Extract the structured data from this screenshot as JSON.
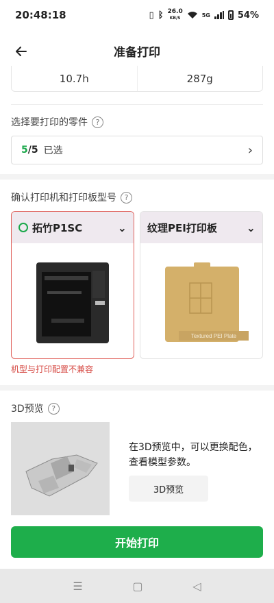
{
  "status_bar": {
    "time": "20:48:18",
    "net_speed": "26.0",
    "net_unit": "KB/S",
    "network": "5G",
    "battery": "54%"
  },
  "header": {
    "title": "准备打印"
  },
  "stats": {
    "time": "10.7h",
    "weight": "287g"
  },
  "parts": {
    "label": "选择要打印的零件",
    "selected": "5",
    "total": "/5",
    "state": "已选"
  },
  "printer_section": {
    "label": "确认打印机和打印板型号",
    "printer": {
      "name": "拓竹P1SC"
    },
    "plate": {
      "name": "纹理PEI打印板",
      "image_caption": "Textured PEI Plate"
    },
    "warning": "机型与打印配置不兼容"
  },
  "preview": {
    "label": "3D预览",
    "description": "在3D预览中，可以更换配色，查看模型参数。",
    "button": "3D预览"
  },
  "start_button": "开始打印",
  "colors": {
    "accent_green": "#1eae4b",
    "warning_red": "#d64a44",
    "plate_gold": "#d4b06a"
  }
}
